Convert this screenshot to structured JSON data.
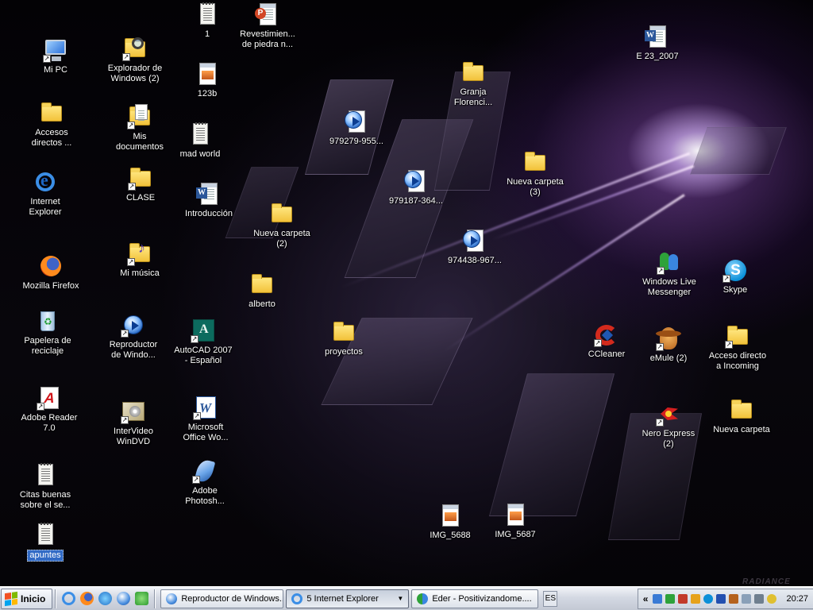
{
  "desktop": {
    "watermark": "RADIANCE",
    "icons": [
      {
        "label": "Mi PC",
        "glyph": "my-computer-icon",
        "shortcut": true
      },
      {
        "label": "Accesos\ndirectos ...",
        "glyph": "folder-icon",
        "shortcut": false
      },
      {
        "label": "Internet\nExplorer",
        "glyph": "internet-explorer-icon",
        "shortcut": false
      },
      {
        "label": "Mozilla Firefox",
        "glyph": "firefox-icon",
        "shortcut": false
      },
      {
        "label": "Papelera de\nreciclaje",
        "glyph": "recycle-bin-icon",
        "shortcut": false
      },
      {
        "label": "Adobe Reader\n7.0",
        "glyph": "adobe-reader-icon",
        "shortcut": true
      },
      {
        "label": "Citas buenas\nsobre el se...",
        "glyph": "text-document-icon",
        "shortcut": false
      },
      {
        "label": "apuntes",
        "glyph": "text-document-icon",
        "shortcut": false,
        "selected": true
      },
      {
        "label": "Explorador de\nWindows (2)",
        "glyph": "windows-explorer-icon",
        "shortcut": true
      },
      {
        "label": "Mis\ndocumentos",
        "glyph": "my-documents-icon",
        "shortcut": true
      },
      {
        "label": "CLASE",
        "glyph": "folder-icon",
        "shortcut": true
      },
      {
        "label": "Mi música",
        "glyph": "my-music-icon",
        "shortcut": true
      },
      {
        "label": "Reproductor\nde Windo...",
        "glyph": "media-player-icon",
        "shortcut": true
      },
      {
        "label": "InterVideo\nWinDVD",
        "glyph": "windvd-icon",
        "shortcut": true
      },
      {
        "label": "1",
        "glyph": "text-document-icon",
        "shortcut": false
      },
      {
        "label": "123b",
        "glyph": "image-file-icon",
        "shortcut": false
      },
      {
        "label": "mad world",
        "glyph": "text-document-icon",
        "shortcut": false
      },
      {
        "label": "Introducción",
        "glyph": "word-document-icon",
        "shortcut": false
      },
      {
        "label": "AutoCAD 2007\n- Español",
        "glyph": "autocad-icon",
        "shortcut": true
      },
      {
        "label": "Microsoft\nOffice Wo...",
        "glyph": "ms-word-icon",
        "shortcut": true
      },
      {
        "label": "Adobe\nPhotosh...",
        "glyph": "photoshop-icon",
        "shortcut": true
      },
      {
        "label": "Revestimien...\nde piedra n...",
        "glyph": "powerpoint-document-icon",
        "shortcut": false
      },
      {
        "label": "Nueva carpeta\n(2)",
        "glyph": "folder-icon",
        "shortcut": false
      },
      {
        "label": "alberto",
        "glyph": "folder-icon",
        "shortcut": false
      },
      {
        "label": "proyectos",
        "glyph": "folder-icon",
        "shortcut": false
      },
      {
        "label": "979279-955...",
        "glyph": "media-file-icon",
        "shortcut": false
      },
      {
        "label": "979187-364...",
        "glyph": "media-file-icon",
        "shortcut": false
      },
      {
        "label": "974438-967...",
        "glyph": "media-file-icon",
        "shortcut": false
      },
      {
        "label": "Granja\nFlorenci...",
        "glyph": "folder-icon",
        "shortcut": false
      },
      {
        "label": "Nueva carpeta\n(3)",
        "glyph": "folder-icon",
        "shortcut": false
      },
      {
        "label": "IMG_5688",
        "glyph": "image-file-icon",
        "shortcut": false
      },
      {
        "label": "IMG_5687",
        "glyph": "image-file-icon",
        "shortcut": false
      },
      {
        "label": "E 23_2007",
        "glyph": "word-document-icon",
        "shortcut": false
      },
      {
        "label": "Windows Live\nMessenger",
        "glyph": "messenger-icon",
        "shortcut": true
      },
      {
        "label": "Skype",
        "glyph": "skype-icon",
        "shortcut": true
      },
      {
        "label": "CCleaner",
        "glyph": "ccleaner-icon",
        "shortcut": true
      },
      {
        "label": "eMule (2)",
        "glyph": "emule-icon",
        "shortcut": true
      },
      {
        "label": "Acceso directo\na Incoming",
        "glyph": "folder-icon",
        "shortcut": true
      },
      {
        "label": "Nero Express\n(2)",
        "glyph": "nero-icon",
        "shortcut": true
      },
      {
        "label": "Nueva carpeta",
        "glyph": "folder-icon",
        "shortcut": false
      }
    ]
  },
  "taskbar": {
    "start_label": "Inicio",
    "quick_launch": [
      "internet-explorer-icon",
      "firefox-icon",
      "messenger-icon",
      "media-player-icon",
      "msn-icon"
    ],
    "tasks": [
      {
        "label": "Reproductor de Windows...",
        "icon": "media-player-icon",
        "active": false
      },
      {
        "label": "5 Internet Explorer",
        "icon": "internet-explorer-icon",
        "active": true,
        "dropdown": true
      },
      {
        "label": "Eder - Positivizandome....",
        "icon": "messenger-icon",
        "active": false
      }
    ],
    "language": "ES",
    "tray_chevron": "«",
    "clock": "20:27"
  },
  "colors": {
    "selection": "#316ac5",
    "taskbar_top": "#f2f4f8",
    "taskbar_bottom": "#c3c9d4",
    "wallpaper_glow": "#a05ad2"
  }
}
